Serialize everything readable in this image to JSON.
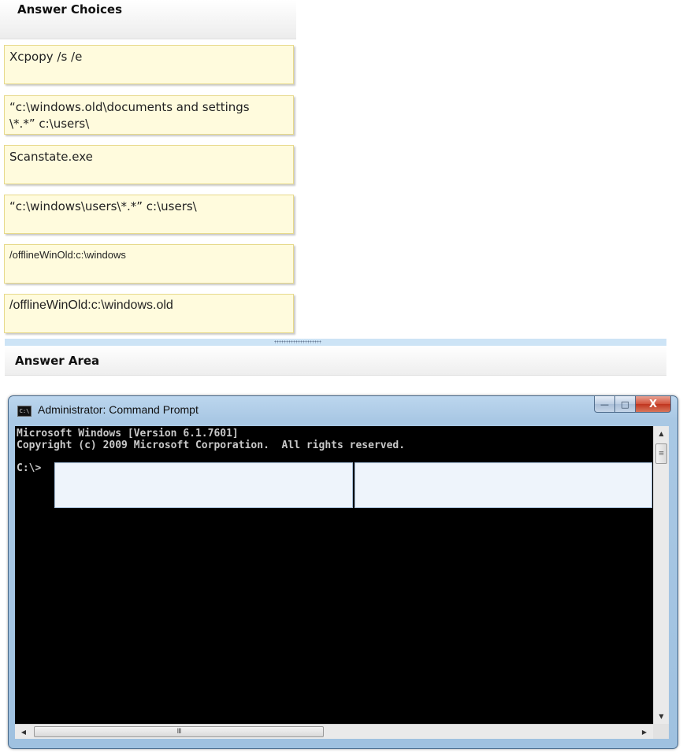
{
  "answer_choices": {
    "title": "Answer Choices",
    "items": [
      {
        "label": "Xcpopy /s /e"
      },
      {
        "label": "“c:\\windows.old\\documents and settings\n\\*.*” c:\\users\\"
      },
      {
        "label": "Scanstate.exe"
      },
      {
        "label": "“c:\\windows\\users\\*.*” c:\\users\\"
      },
      {
        "label": "/offlineWinOld:c:\\windows"
      },
      {
        "label": "/offlineWinOld:c:\\windows.old"
      }
    ]
  },
  "answer_area": {
    "title": "Answer Area"
  },
  "cmd_window": {
    "title": "Administrator: Command Prompt",
    "icon_text": "C:\\",
    "minimize_glyph": "—",
    "maximize_glyph": "□",
    "close_glyph": "X",
    "console_text": "Microsoft Windows [Version 6.1.7601]\nCopyright (c) 2009 Microsoft Corporation.  All rights reserved.",
    "prompt": "C:\\>",
    "scroll_up": "▲",
    "scroll_down": "▼",
    "scroll_left": "◀",
    "scroll_right": "▶",
    "hthumb_grip": "III",
    "vthumb_grip": "≡"
  }
}
